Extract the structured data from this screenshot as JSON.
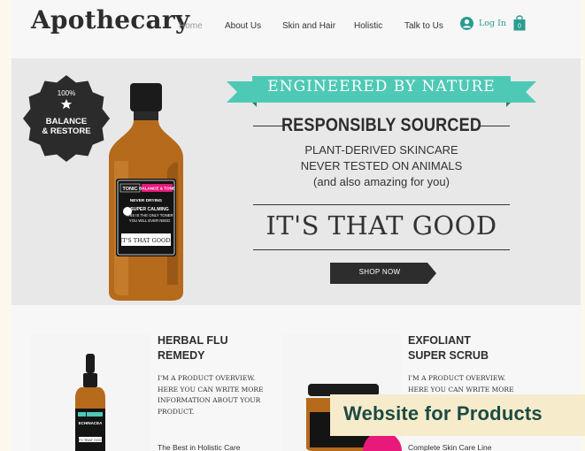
{
  "header": {
    "logo": "Apothecary",
    "nav": [
      "Home",
      "About Us",
      "Skin and Hair",
      "Holistic",
      "Talk to Us"
    ],
    "login_label": "Log In",
    "cart_count": "0"
  },
  "hero": {
    "seal_percent": "100%",
    "seal_line1": "BALANCE",
    "seal_line2": "& RESTORE",
    "ribbon": "ENGINEERED BY NATURE",
    "sourced": "RESPONSIBLY SOURCED",
    "lines": [
      "PLANT-DERIVED SKINCARE",
      "NEVER TESTED ON ANIMALS",
      "(and also amazing for you)"
    ],
    "tagline": "IT'S THAT GOOD",
    "cta": "SHOP NOW",
    "bottle": {
      "label_top": "TONIC",
      "label_pink": "BALANCE & TONE",
      "never_drying": "NEVER DRYING",
      "calming": "SUPER CALMING",
      "calming_sub": "THIS IS THE ONLY TONER",
      "calming_sub2": "YOU WILL EVER NEED",
      "good": "IT'S THAT GOOD."
    }
  },
  "products": [
    {
      "title_line1": "HERBAL FLU",
      "title_line2": "REMEDY",
      "desc": [
        "I'M A PRODUCT OVERVIEW.",
        "HERE YOU CAN WRITE MORE",
        "INFORMATION ABOUT YOUR",
        "PRODUCT."
      ],
      "tag": "The Best in Holistic Care",
      "bottle_label": "ECHINACEA",
      "bottle_good": "IT'S THAT GOOD"
    },
    {
      "title_line1": "EXFOLIANT",
      "title_line2": "SUPER SCRUB",
      "desc": [
        "I'M A PRODUCT OVERVIEW.",
        "HERE YOU CAN WRITE MORE"
      ],
      "tag": "Complete Skin Care Line"
    }
  ],
  "overlay": "Website for Products",
  "colors": {
    "teal": "#4ec9b5",
    "teal_dark": "#2a9c8f",
    "pink": "#e8197b",
    "amber": "#b56a1c"
  }
}
